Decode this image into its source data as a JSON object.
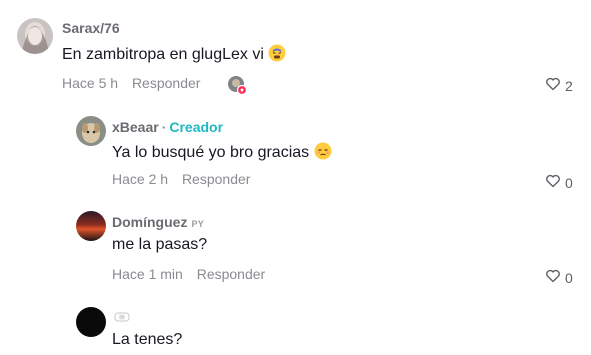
{
  "comments": [
    {
      "username": "Sarax/76",
      "text": "En zambitropa en glugLex vi",
      "time": "Hace 5 h",
      "reply_label": "Responder",
      "likes": "2"
    },
    {
      "username": "xBeaar",
      "separator": "·",
      "badge": "Creador",
      "text": "Ya lo busqué yo bro gracias",
      "time": "Hace 2 h",
      "reply_label": "Responder",
      "likes": "0"
    },
    {
      "username": "Domínguez",
      "flag": "PY",
      "text": "me la pasas?",
      "time": "Hace 1 min",
      "reply_label": "Responder",
      "likes": "0"
    },
    {
      "username": "",
      "text": "La tenes?"
    }
  ],
  "colors": {
    "creator_badge": "#20b8c4",
    "meta_text": "#8a8b91",
    "liked_by_creator_badge": "#fe2c55"
  },
  "icons": [
    "heart-outline-icon",
    "tired-face-emoji",
    "pensive-face-emoji",
    "creator-liked-badge",
    "bandage-emoji"
  ]
}
